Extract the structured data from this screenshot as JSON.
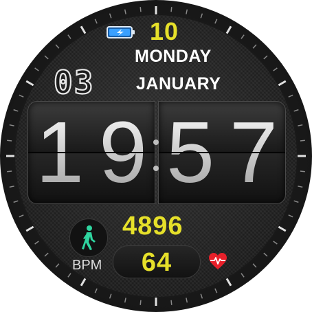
{
  "status": {
    "battery_icon": "battery-charging-icon",
    "battery_color": "#3aa0ff"
  },
  "date": {
    "day_of_month_top": "10",
    "weekday": "MONDAY",
    "month": "JANUARY",
    "day_of_month_box": "03"
  },
  "time": {
    "hour_tens": "1",
    "hour_ones": "9",
    "minute_tens": "5",
    "minute_ones": "7"
  },
  "activity": {
    "steps": "4896",
    "steps_icon": "walking-person-icon",
    "steps_icon_color": "#2fd6a0"
  },
  "heart": {
    "label": "BPM",
    "value": "64",
    "icon": "heart-pulse-icon",
    "icon_color": "#e8202a"
  },
  "colors": {
    "accent": "#e6e02a",
    "text": "#ffffff"
  }
}
